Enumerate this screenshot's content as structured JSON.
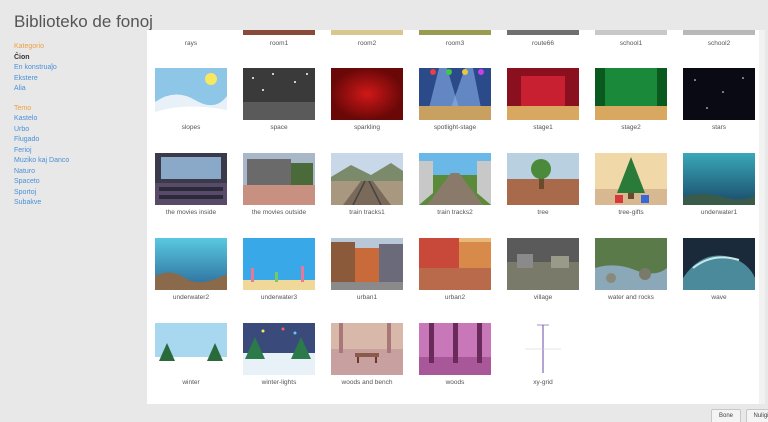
{
  "dialog": {
    "title": "Biblioteko de fonoj"
  },
  "sidebar": {
    "category_header": "Kategorio",
    "categories": [
      "Ĉion",
      "En konstruaĵo",
      "Ekstere",
      "Alia"
    ],
    "theme_header": "Temo",
    "themes": [
      "Kastelo",
      "Urbo",
      "Flugado",
      "Ferioj",
      "Muziko kaj Danco",
      "Naturo",
      "Spaceto",
      "Sportoj",
      "Subakve"
    ]
  },
  "top_row_labels": [
    "rays",
    "room1",
    "room2",
    "room3",
    "route66",
    "school1",
    "school2"
  ],
  "rows": [
    [
      {
        "label": "slopes",
        "icon": "slopes-thumbnail"
      },
      {
        "label": "space",
        "icon": "space-thumbnail"
      },
      {
        "label": "sparkling",
        "icon": "sparkling-thumbnail"
      },
      {
        "label": "spotlight-stage",
        "icon": "spotlight-stage-thumbnail"
      },
      {
        "label": "stage1",
        "icon": "stage1-thumbnail"
      },
      {
        "label": "stage2",
        "icon": "stage2-thumbnail"
      },
      {
        "label": "stars",
        "icon": "stars-thumbnail"
      }
    ],
    [
      {
        "label": "the movies inside",
        "icon": "movies-inside-thumbnail"
      },
      {
        "label": "the movies outside",
        "icon": "movies-outside-thumbnail"
      },
      {
        "label": "train tracks1",
        "icon": "train-tracks1-thumbnail"
      },
      {
        "label": "train tracks2",
        "icon": "train-tracks2-thumbnail"
      },
      {
        "label": "tree",
        "icon": "tree-thumbnail"
      },
      {
        "label": "tree-gifts",
        "icon": "tree-gifts-thumbnail"
      },
      {
        "label": "underwater1",
        "icon": "underwater1-thumbnail"
      }
    ],
    [
      {
        "label": "underwater2",
        "icon": "underwater2-thumbnail"
      },
      {
        "label": "underwater3",
        "icon": "underwater3-thumbnail"
      },
      {
        "label": "urban1",
        "icon": "urban1-thumbnail"
      },
      {
        "label": "urban2",
        "icon": "urban2-thumbnail"
      },
      {
        "label": "village",
        "icon": "village-thumbnail"
      },
      {
        "label": "water and rocks",
        "icon": "water-rocks-thumbnail"
      },
      {
        "label": "wave",
        "icon": "wave-thumbnail"
      }
    ],
    [
      {
        "label": "winter",
        "icon": "winter-thumbnail"
      },
      {
        "label": "winter-lights",
        "icon": "winter-lights-thumbnail"
      },
      {
        "label": "woods and bench",
        "icon": "woods-bench-thumbnail"
      },
      {
        "label": "woods",
        "icon": "woods-thumbnail"
      },
      {
        "label": "xy-grid",
        "icon": "xy-grid-thumbnail"
      }
    ]
  ],
  "buttons": {
    "ok": "Bone",
    "cancel": "Nuligi"
  },
  "colors": {
    "category_header": "#f0a040",
    "link": "#4a90d9",
    "selected": "#333333"
  }
}
